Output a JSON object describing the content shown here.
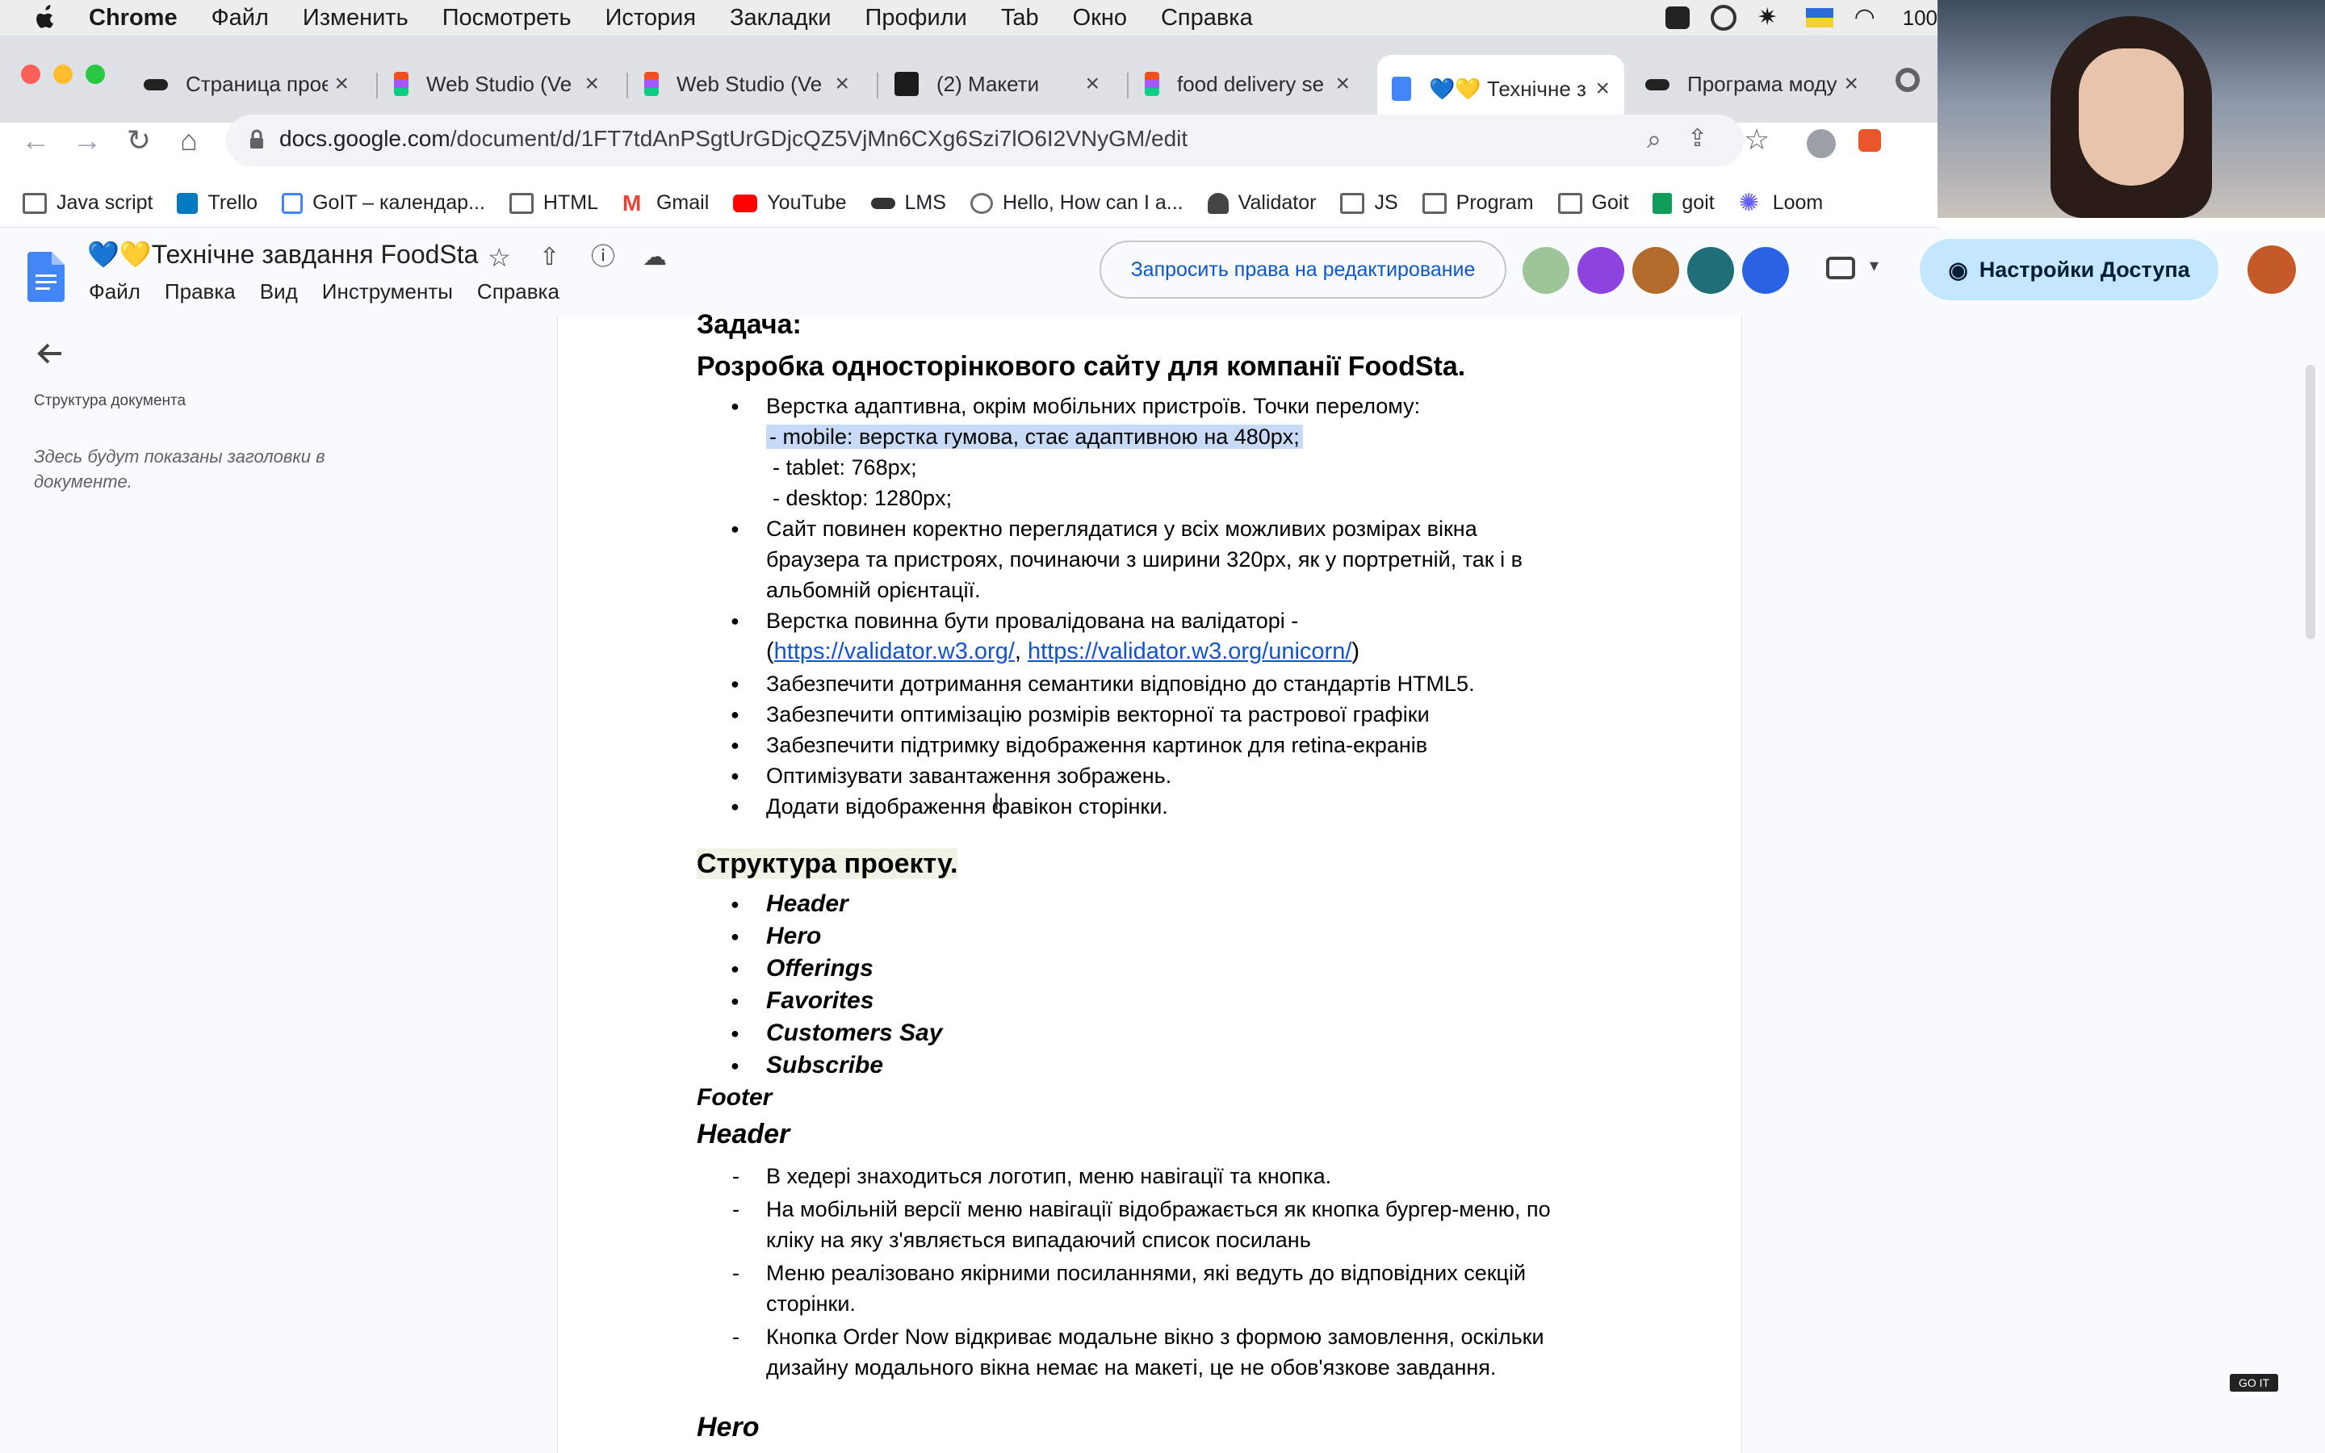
{
  "mac_menu": {
    "app": "Chrome",
    "items": [
      "Файл",
      "Изменить",
      "Посмотреть",
      "История",
      "Закладки",
      "Профили",
      "Tab",
      "Окно",
      "Справка"
    ],
    "battery": "100"
  },
  "tabs": [
    {
      "label": "Страница прое",
      "icon": "goit-icon",
      "active": false
    },
    {
      "label": "Web Studio (Ve",
      "icon": "figma-icon",
      "active": false
    },
    {
      "label": "Web Studio (Ve",
      "icon": "figma-icon",
      "active": false
    },
    {
      "label": "(2) Макети",
      "icon": "doc-dark-icon",
      "active": false
    },
    {
      "label": "food delivery se",
      "icon": "figma-icon",
      "active": false
    },
    {
      "label": "💙💛 Технічне з",
      "icon": "google-docs-icon",
      "active": true
    },
    {
      "label": "Програма моду",
      "icon": "goit-icon",
      "active": false
    }
  ],
  "address_bar": {
    "host": "docs.google.com",
    "path": "/document/d/1FT7tdAnPSgtUrGDjcQZ5VjMn6CXg6Szi7lO6I2VNyGM/edit"
  },
  "bookmarks": [
    "Java script",
    "Trello",
    "GoIT – календар...",
    "HTML",
    "Gmail",
    "YouTube",
    "LMS",
    "Hello, How can I a...",
    "Validator",
    "JS",
    "Program",
    "Goit",
    "goit",
    "Loom"
  ],
  "docs": {
    "title": "💙💛Технічне завдання FoodSta",
    "menu": [
      "Файл",
      "Правка",
      "Вид",
      "Инструменты",
      "Справка"
    ],
    "request_button": "Запросить права на редактирование",
    "share_button": "Настройки Доступа"
  },
  "outline": {
    "title": "Структура документа",
    "hint": "Здесь будут показаны заголовки в документе."
  },
  "content": {
    "task_heading": "Задача:",
    "task_title": "Розробка односторінкового сайту для компанії FoodSta.",
    "req1": "Верстка адаптивна, окрім мобільних пристроїв. Точки перелому:",
    "req1_mobile": "- mobile: верстка гумова, стає адаптивною на 480px;",
    "req1_tablet": "- tablet: 768px;",
    "req1_desktop": "- desktop: 1280px;",
    "req2_l1": "Сайт повинен коректно переглядатися у всіх можливих розмірах вікна",
    "req2_l2": "браузера та пристроях, починаючи з ширини 320px, як у портретній, так і в",
    "req2_l3": "альбомній орієнтації.",
    "req3_l1": "Верстка повинна бути провалідована на валідаторі -",
    "link1": "https://validator.w3.org/",
    "link2": "https://validator.w3.org/unicorn/",
    "req4": "Забезпечити дотримання семантики відповідно до стандартів HTML5.",
    "req5": "Забезпечити оптимізацію розмірів векторної та растрової графіки",
    "req6": "Забезпечити підтримку відображення картинок для retina-екранів",
    "req7": "Оптимізувати завантаження зображень.",
    "req8": "Додати відображення фавікон сторінки.",
    "structure_heading": "Структура проекту.",
    "sections": [
      "Header",
      "Hero",
      "Offerings",
      "Favorites",
      "Customers Say",
      "Subscribe"
    ],
    "footer_label": "Footer",
    "header_heading": "Header",
    "header_items": [
      {
        "l1": "В хедері знаходиться логотип, меню навігації та кнопка.",
        "l2": ""
      },
      {
        "l1": "На мобільній версії меню навігації відображається як кнопка бургер-меню, по",
        "l2": "кліку на яку з'являється випадаючий список посилань"
      },
      {
        "l1": "Меню реалізовано якірними посиланнями, які ведуть до відповідних секцій",
        "l2": "сторінки."
      },
      {
        "l1": "Кнопка Order Now відкриває модальне вікно з формою замовлення, оскільки",
        "l2": "дизайну модального вікна немає на макеті, це не обов'язкове завдання."
      }
    ],
    "hero_heading": "Hero"
  },
  "badge": "GO IT",
  "colors": {
    "accent": "#0b57d0",
    "share_bg": "#c2e7ff",
    "selection": "#c7dbf8",
    "link": "#1155cc"
  }
}
